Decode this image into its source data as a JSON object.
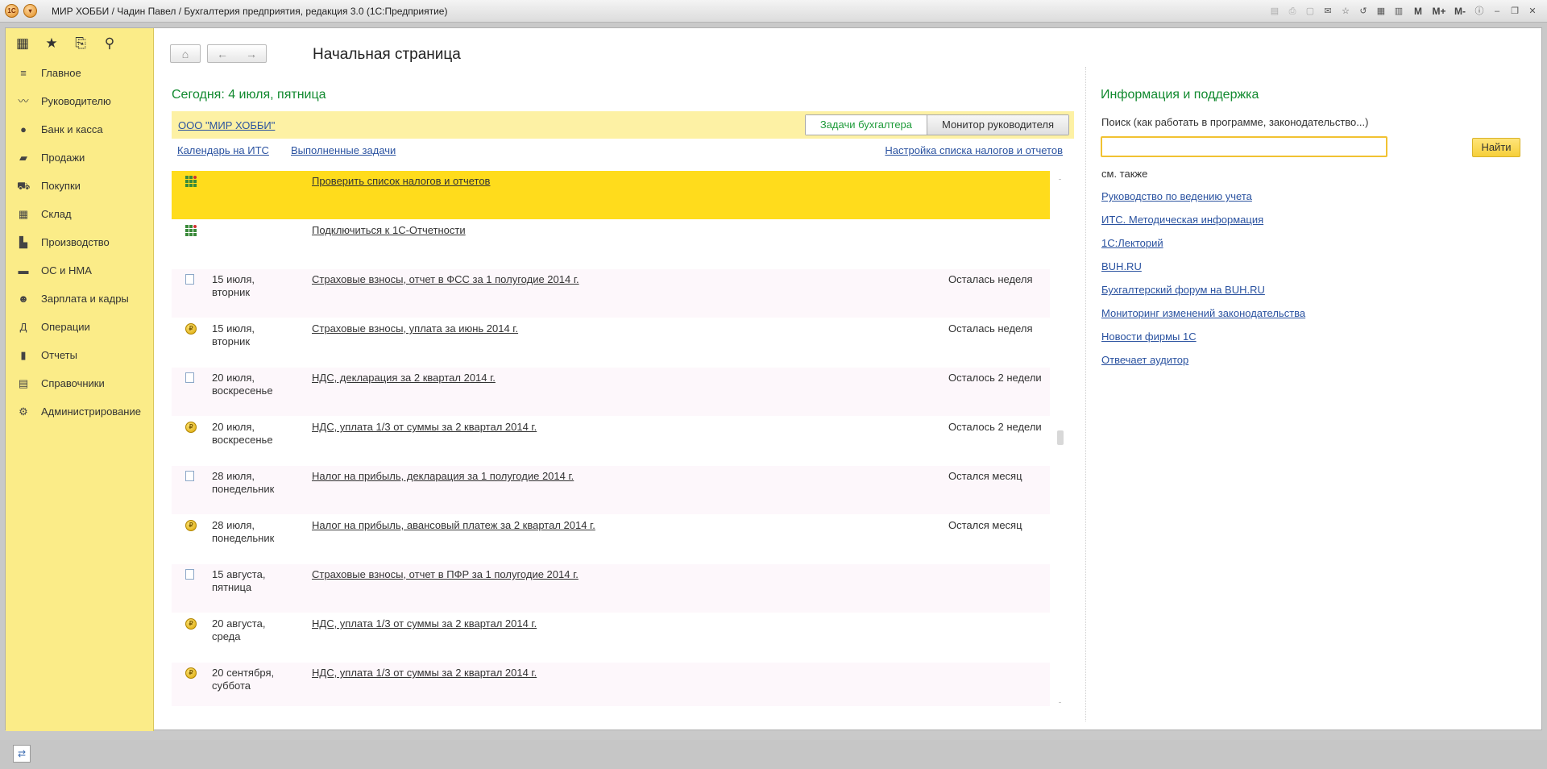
{
  "window": {
    "title": "МИР ХОББИ / Чадин Павел / Бухгалтерия предприятия, редакция 3.0  (1С:Предприятие)",
    "app_icon": "1C",
    "right_icons": [
      "save-icon",
      "print-icon",
      "preview-icon",
      "mail-icon",
      "favorite-add-icon",
      "history-icon",
      "calendar-icon",
      "calculator-icon"
    ],
    "memory_buttons": [
      "M",
      "M+",
      "M-"
    ],
    "window_controls": [
      "info-icon",
      "minimize-icon",
      "restore-icon",
      "close-icon"
    ]
  },
  "sidebar": {
    "tools": [
      "apps-icon",
      "star-icon",
      "history-icon",
      "search-icon"
    ],
    "items": [
      {
        "label": "Главное",
        "icon": "menu-icon"
      },
      {
        "label": "Руководителю",
        "icon": "trend-icon"
      },
      {
        "label": "Банк и касса",
        "icon": "ruble-coin-icon"
      },
      {
        "label": "Продажи",
        "icon": "bag-icon"
      },
      {
        "label": "Покупки",
        "icon": "cart-icon"
      },
      {
        "label": "Склад",
        "icon": "warehouse-icon"
      },
      {
        "label": "Производство",
        "icon": "factory-icon"
      },
      {
        "label": "ОС и НМА",
        "icon": "truck-icon"
      },
      {
        "label": "Зарплата и кадры",
        "icon": "person-icon"
      },
      {
        "label": "Операции",
        "icon": "operations-icon"
      },
      {
        "label": "Отчеты",
        "icon": "bar-chart-icon"
      },
      {
        "label": "Справочники",
        "icon": "book-icon"
      },
      {
        "label": "Администрирование",
        "icon": "gear-icon"
      }
    ]
  },
  "header": {
    "title": "Начальная страница"
  },
  "today": {
    "title": "Сегодня: 4 июля, пятница",
    "org_link": "ООО \"МИР ХОББИ\"",
    "tabs": [
      "Задачи бухгалтера",
      "Монитор руководителя"
    ],
    "active_tab": "Задачи бухгалтера",
    "links": {
      "calendar": "Календарь на ИТС",
      "done": "Выполненные задачи",
      "settings": "Настройка списка налогов и отчетов"
    }
  },
  "tasks": [
    {
      "icon": "task-grid-icon",
      "date": "",
      "label": "Проверить список налогов и отчетов",
      "remaining": "",
      "style": "highlight"
    },
    {
      "icon": "task-grid-icon",
      "date": "",
      "label": "Подключиться к 1С-Отчетности",
      "remaining": "",
      "style": "plain"
    },
    {
      "icon": "document-icon",
      "date": "15 июля,\nвторник",
      "label": "Страховые взносы, отчет в ФСС за 1 полугодие 2014 г.",
      "remaining": "Осталась неделя",
      "style": "pink"
    },
    {
      "icon": "payment-coin-icon",
      "date": "15 июля,\nвторник",
      "label": "Страховые взносы, уплата за июнь 2014 г.",
      "remaining": "Осталась неделя",
      "style": "plain"
    },
    {
      "icon": "document-icon",
      "date": "20 июля,\nвоскресенье",
      "label": "НДС, декларация за 2 квартал 2014 г.",
      "remaining": "Осталось 2 недели",
      "style": "pink"
    },
    {
      "icon": "payment-coin-icon",
      "date": "20 июля,\nвоскресенье",
      "label": "НДС, уплата 1/3 от суммы за 2 квартал 2014 г.",
      "remaining": "Осталось 2 недели",
      "style": "plain"
    },
    {
      "icon": "document-icon",
      "date": "28 июля,\nпонедельник",
      "label": "Налог на прибыль, декларация за 1 полугодие 2014 г.",
      "remaining": "Остался месяц",
      "style": "pink"
    },
    {
      "icon": "payment-coin-icon",
      "date": "28 июля,\nпонедельник",
      "label": "Налог на прибыль, авансовый платеж за 2 квартал 2014 г.",
      "remaining": "Остался месяц",
      "style": "plain"
    },
    {
      "icon": "document-icon",
      "date": "15 августа,\nпятница",
      "label": "Страховые взносы, отчет в ПФР за 1 полугодие 2014 г.",
      "remaining": "",
      "style": "pink"
    },
    {
      "icon": "payment-coin-icon",
      "date": "20 августа,\nсреда",
      "label": "НДС, уплата 1/3 от суммы за 2 квартал 2014 г.",
      "remaining": "",
      "style": "plain"
    },
    {
      "icon": "payment-coin-icon",
      "date": "20 сентября,\nсуббота",
      "label": "НДС, уплата 1/3 от суммы за 2 квартал 2014 г.",
      "remaining": "",
      "style": "pink"
    }
  ],
  "info": {
    "title": "Информация и поддержка",
    "search_label": "Поиск (как работать в программе, законодательство...)",
    "search_value": "",
    "search_button": "Найти",
    "see_also": "см. также",
    "links": [
      "Руководство по ведению учета",
      "ИТС. Методическая информация",
      "1С:Лекторий",
      "BUH.RU",
      "Бухгалтерский форум на BUH.RU",
      "Мониторинг изменений законодательства",
      "Новости фирмы 1С",
      "Отвечает аудитор"
    ]
  },
  "statusbar": {
    "icon": "connection-icon"
  },
  "colors": {
    "sidebar_bg": "#fbec88",
    "accent_green": "#118a2f",
    "highlight_row": "#ffdc1c",
    "link_blue": "#2a52a0",
    "find_button": "#f6cf3a"
  }
}
